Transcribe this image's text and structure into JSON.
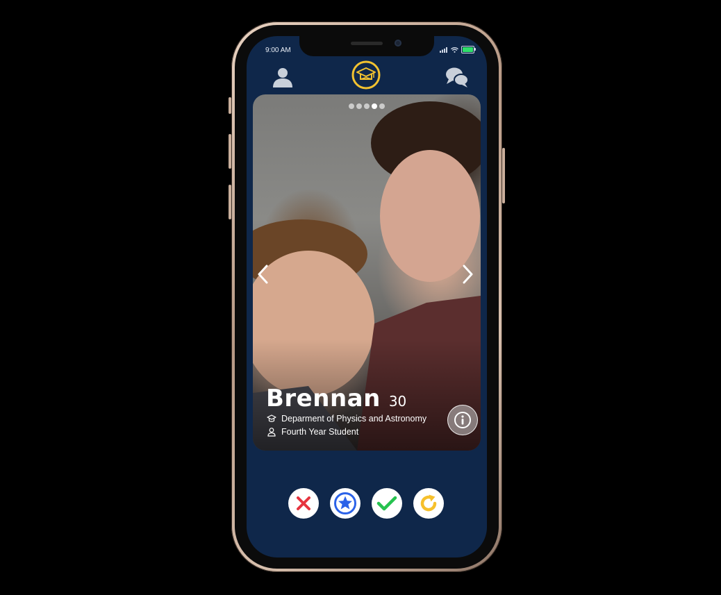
{
  "status_bar": {
    "time": "9:00 AM"
  },
  "profile": {
    "name": "Brennan",
    "age": "30",
    "department": "Deparment of Physics and Astronomy",
    "year": "Fourth Year Student",
    "photo_count": 5,
    "active_photo_index": 4
  },
  "icons": {
    "nav_left": "user-icon",
    "nav_center": "graduation-cap-logo-icon",
    "nav_right": "chat-bubbles-icon",
    "department_icon": "graduation-cap-icon",
    "year_icon": "person-icon",
    "info": "info-icon",
    "actions": [
      "close-icon",
      "star-icon",
      "check-icon",
      "undo-icon"
    ]
  },
  "colors": {
    "screen_bg": "#0f274a",
    "logo_gold": "#f2c230",
    "reject_red": "#e6343f",
    "super_blue": "#2b62e8",
    "like_green": "#26c24f",
    "rewind_yellow": "#f6c02c"
  }
}
